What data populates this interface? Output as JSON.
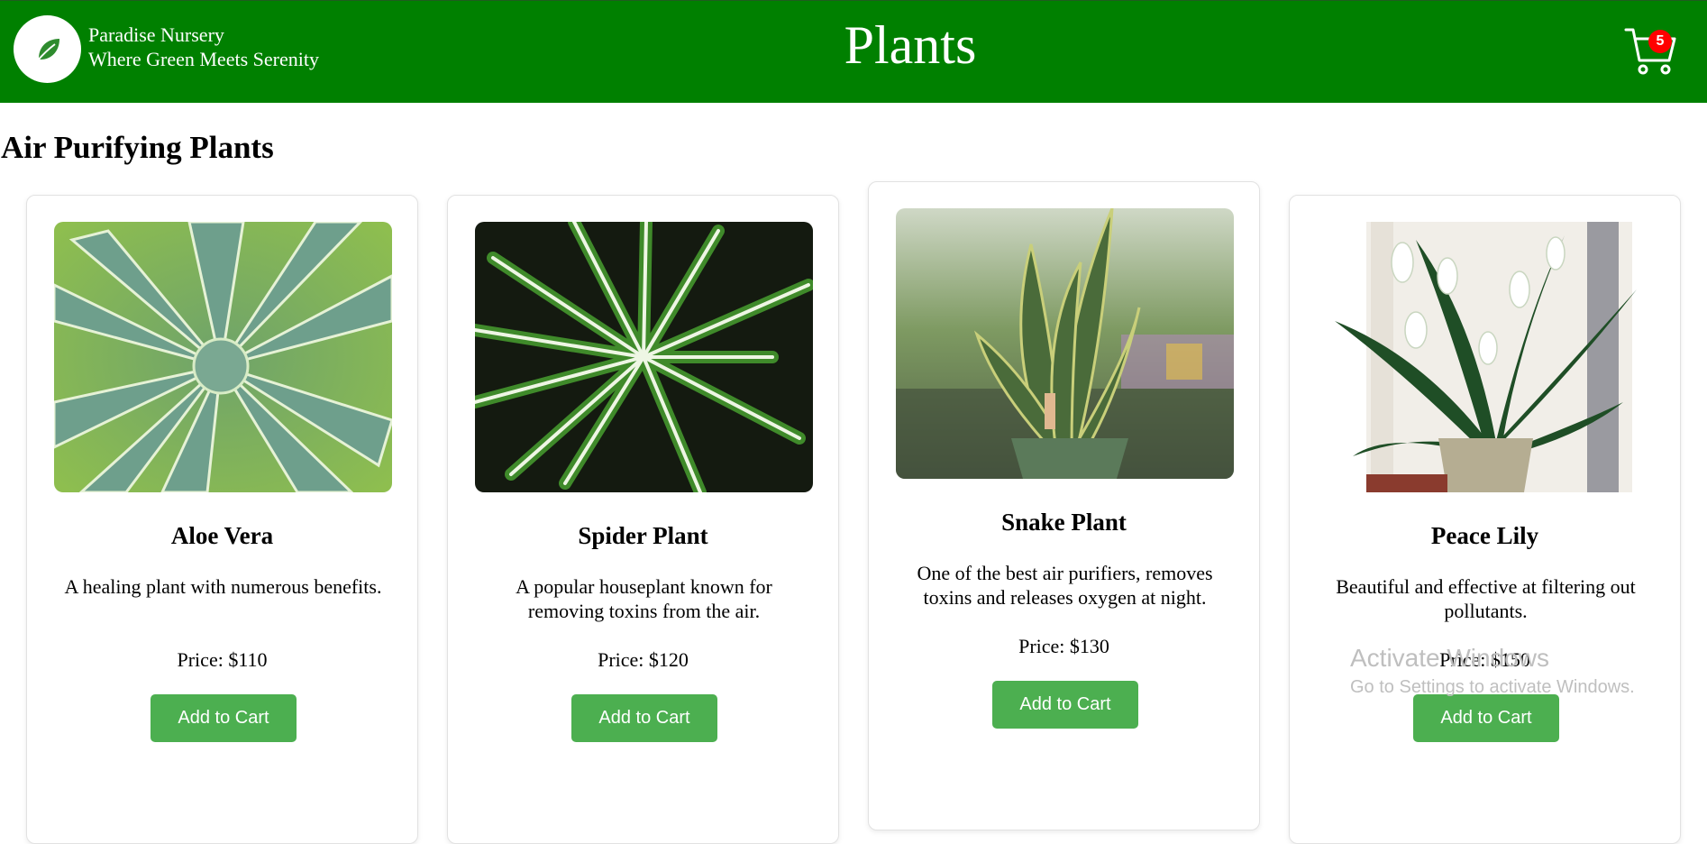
{
  "header": {
    "brand_name": "Paradise Nursery",
    "tagline": "Where Green Meets Serenity",
    "title": "Plants",
    "logo_icon": "leaf-icon",
    "cart_icon": "cart-icon",
    "cart_count": "5",
    "colors": {
      "navbar": "#008000",
      "badge": "#ff0000"
    }
  },
  "section": {
    "title": "Air Purifying Plants"
  },
  "plants": [
    {
      "name": "Aloe Vera",
      "description": "A healing plant with numerous benefits.",
      "price": "Price: $110",
      "button": "Add to Cart",
      "image": "aloe-vera-photo"
    },
    {
      "name": "Spider Plant",
      "description": "A popular houseplant known for removing toxins from the air.",
      "price": "Price: $120",
      "button": "Add to Cart",
      "image": "spider-plant-photo"
    },
    {
      "name": "Snake Plant",
      "description": "One of the best air purifiers, removes toxins and releases oxygen at night.",
      "price": "Price: $130",
      "button": "Add to Cart",
      "image": "snake-plant-photo"
    },
    {
      "name": "Peace Lily",
      "description": "Beautiful and effective at filtering out pollutants.",
      "price": "Price: $150",
      "button": "Add to Cart",
      "image": "peace-lily-photo"
    }
  ],
  "button_color": "#4caf50",
  "watermark": {
    "line1": "Activate Windows",
    "line2": "Go to Settings to activate Windows."
  }
}
